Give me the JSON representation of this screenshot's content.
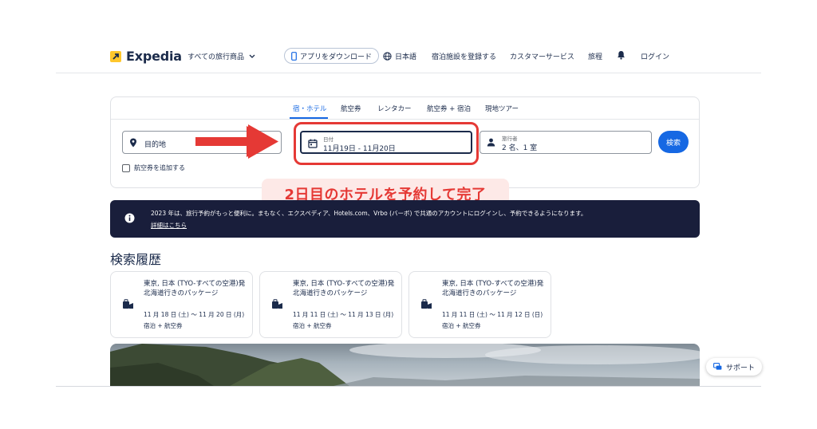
{
  "header": {
    "logo_text": "Expedia",
    "shop_menu": "すべての旅行商品",
    "app_download": "アプリをダウンロード",
    "language": "日本語",
    "list_property": "宿泊施設を登録する",
    "customer_service": "カスタマーサービス",
    "trips": "旅程",
    "login": "ログイン"
  },
  "search": {
    "tabs": [
      "宿・ホテル",
      "航空券",
      "レンタカー",
      "航空券 + 宿泊",
      "現地ツアー"
    ],
    "active_tab": "宿・ホテル",
    "destination_placeholder": "目的地",
    "dates_label": "日付",
    "dates_value": "11月19日 - 11月20日",
    "travelers_label": "旅行者",
    "travelers_value": "2 名、1 室",
    "search_button": "検索",
    "add_flight": "航空券を追加する"
  },
  "annotation": {
    "callout": "2日目のホテルを予約して完了",
    "arrow_color": "#e53935"
  },
  "banner": {
    "text": "2023 年は、旅行予約がもっと便利に。まもなく、エクスペディア、Hotels.com、Vrbo (バーボ) で共通のアカウントにログインし、予約できるようになります。",
    "link": "詳細はこちら"
  },
  "history": {
    "title": "検索履歴",
    "cards": [
      {
        "title": "東京, 日本 (TYO-すべての空港)発北海道行きのパッケージ",
        "dates": "11 月 18 日 (土) ～ 11 月 20 日 (月)",
        "type": "宿泊 + 航空券"
      },
      {
        "title": "東京, 日本 (TYO-すべての空港)発北海道行きのパッケージ",
        "dates": "11 月 11 日 (土) ～ 11 月 13 日 (月)",
        "type": "宿泊 + 航空券"
      },
      {
        "title": "東京, 日本 (TYO-すべての空港)発北海道行きのパッケージ",
        "dates": "11 月 11 日 (土) ～ 11 月 12 日 (日)",
        "type": "宿泊 + 航空券"
      }
    ]
  },
  "support": {
    "label": "サポート"
  },
  "colors": {
    "brand_blue": "#1668e3",
    "logo_yellow": "#ffc72c",
    "banner_bg": "#191e3b",
    "highlight_red": "#e53935"
  }
}
